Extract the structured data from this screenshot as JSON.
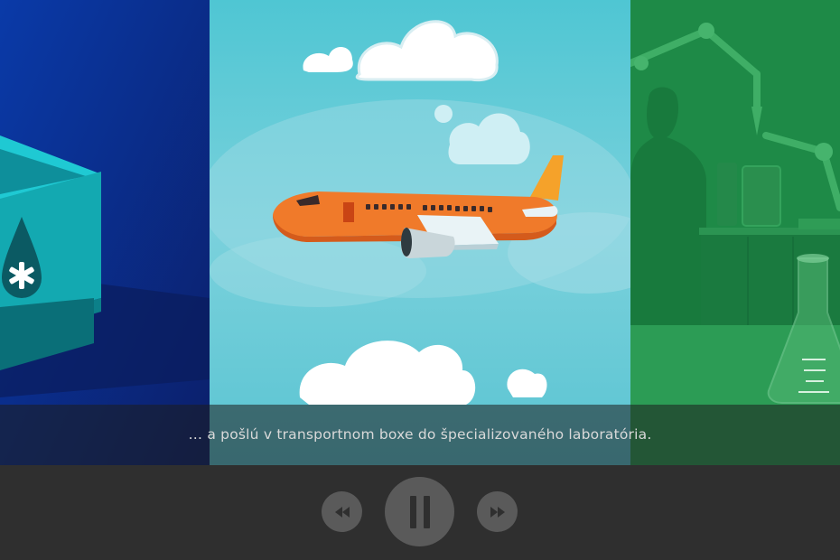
{
  "subtitle": {
    "text": "… a pošlú v transportnom boxe do špecializovaného laboratória."
  },
  "controls": {
    "rewind_icon": "rewind-icon",
    "pause_icon": "pause-icon",
    "forward_icon": "fast-forward-icon"
  },
  "colors": {
    "left_panel": "#0b2a8c",
    "middle_sky": "#5fc7d6",
    "right_panel": "#1f8a48",
    "controls_bg": "#2f2f2f",
    "button_bg": "#5a5a5a",
    "subtitle_text": "#d9d9d9"
  }
}
